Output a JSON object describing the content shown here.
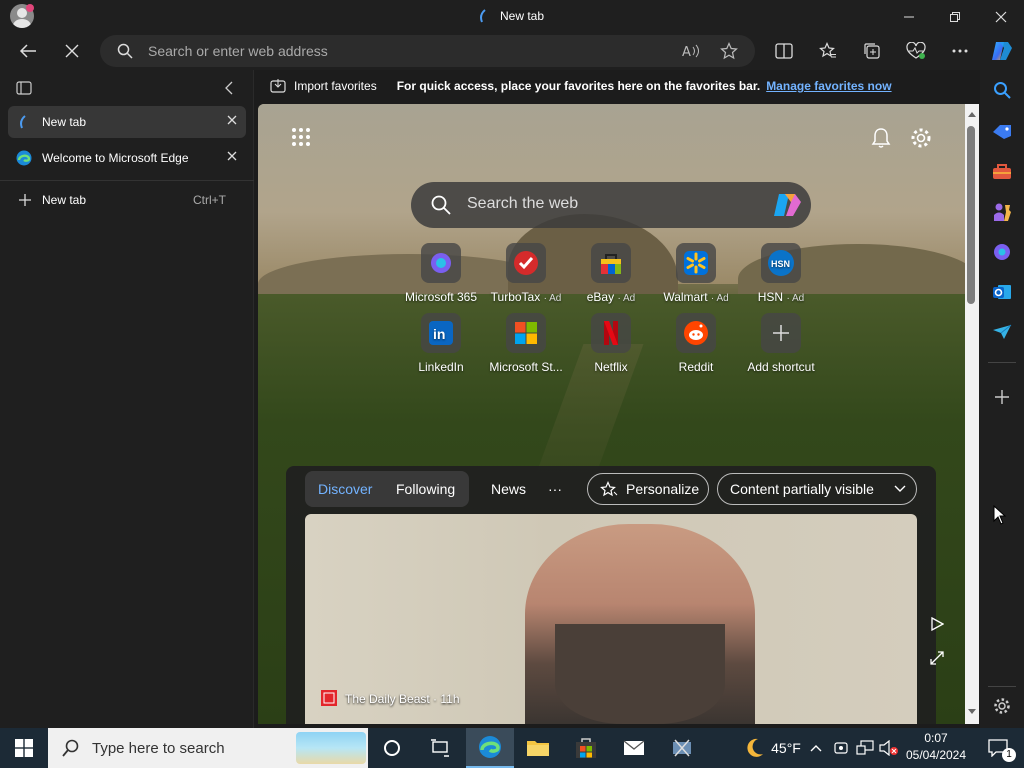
{
  "window": {
    "title": "New tab"
  },
  "toolbar": {
    "address_placeholder": "Search or enter web address"
  },
  "favorites_bar": {
    "import_label": "Import favorites",
    "hint": "For quick access, place your favorites here on the favorites bar.",
    "manage_link": "Manage favorites now"
  },
  "vertical_tabs": {
    "tabs": [
      {
        "label": "New tab",
        "active": true
      },
      {
        "label": "Welcome to Microsoft Edge",
        "active": false
      }
    ],
    "new_tab_label": "New tab",
    "new_tab_shortcut": "Ctrl+T"
  },
  "newtab": {
    "search_placeholder": "Search the web",
    "shortcuts": [
      {
        "label": "Microsoft 365",
        "ad": ""
      },
      {
        "label": "TurboTax",
        "ad": "· Ad"
      },
      {
        "label": "eBay",
        "ad": "· Ad"
      },
      {
        "label": "Walmart",
        "ad": "· Ad"
      },
      {
        "label": "HSN",
        "ad": "· Ad"
      },
      {
        "label": "LinkedIn",
        "ad": ""
      },
      {
        "label": "Microsoft St...",
        "ad": ""
      },
      {
        "label": "Netflix",
        "ad": ""
      },
      {
        "label": "Reddit",
        "ad": ""
      },
      {
        "label": "Add shortcut",
        "ad": ""
      }
    ],
    "feed": {
      "tabs": [
        "Discover",
        "Following",
        "News"
      ],
      "more": "···",
      "personalize": "Personalize",
      "content_visibility": "Content partially visible",
      "story_source": "The Daily Beast",
      "story_age": "· 11h"
    }
  },
  "taskbar": {
    "search_placeholder": "Type here to search",
    "weather": "45°F",
    "time": "0:07",
    "date": "05/04/2024",
    "notifications": "1"
  },
  "colors": {
    "accent": "#4c9bf0",
    "link": "#73b3ff"
  }
}
